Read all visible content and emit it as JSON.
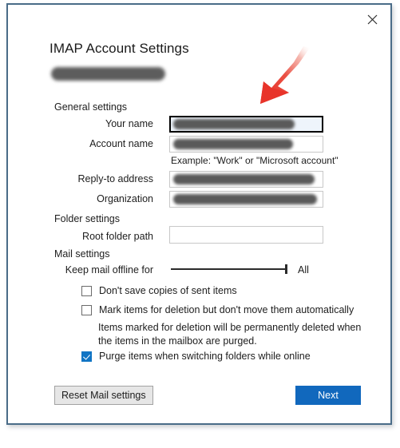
{
  "dialog": {
    "title": "IMAP Account Settings",
    "close_icon": "close-icon",
    "account_redacted": true
  },
  "sections": {
    "general": {
      "label": "General settings"
    },
    "folder": {
      "label": "Folder settings"
    },
    "mail": {
      "label": "Mail settings"
    }
  },
  "fields": {
    "your_name": {
      "label": "Your name",
      "value": "",
      "redacted": true,
      "focused": true
    },
    "account_name": {
      "label": "Account name",
      "value": "",
      "redacted": true,
      "focused": false
    },
    "account_name_hint": "Example: \"Work\" or \"Microsoft account\"",
    "reply_to": {
      "label": "Reply-to address",
      "value": "",
      "redacted": true,
      "focused": false
    },
    "organization": {
      "label": "Organization",
      "value": "",
      "redacted": true,
      "focused": false
    },
    "root_folder_path": {
      "label": "Root folder path",
      "value": "",
      "redacted": false,
      "focused": false
    }
  },
  "mail_settings": {
    "keep_offline_label": "Keep mail offline for",
    "keep_offline_value": "All",
    "slider_percent": 100,
    "checkboxes": [
      {
        "label": "Don't save copies of sent items",
        "checked": false
      },
      {
        "label": "Mark items for deletion but don't move them automatically",
        "checked": false
      },
      {
        "label": "Purge items when switching folders while online",
        "checked": true
      }
    ],
    "deletion_note": "Items marked for deletion will be permanently deleted when the items in the mailbox are purged."
  },
  "buttons": {
    "reset": "Reset Mail settings",
    "next": "Next"
  },
  "annotation": {
    "arrow": "red-arrow-annotation",
    "color": "#e8342a",
    "points_to": "your-name-input"
  },
  "colors": {
    "accent_blue": "#1168bd",
    "checkbox_blue": "#1074c4",
    "window_border": "#4a6c88",
    "annotation_red": "#e8342a"
  }
}
